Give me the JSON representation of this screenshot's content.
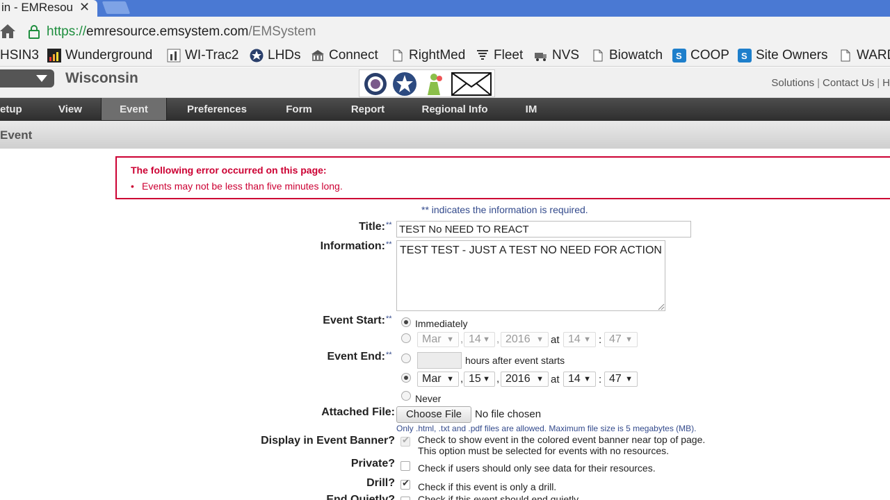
{
  "browser": {
    "tab_title": "in - EMResou",
    "tab_close": "✕",
    "url_scheme": "https://",
    "url_host": "emresource.emsystem.com",
    "url_path": "/EMSystem",
    "bookmarks": [
      "HSIN3",
      "Wunderground",
      "WI-Trac2",
      "LHDs",
      "Connect",
      "RightMed",
      "Fleet",
      "NVS",
      "Biowatch",
      "COOP",
      "Site Owners",
      "WARD"
    ]
  },
  "header": {
    "region": "Wisconsin",
    "links": [
      "Solutions",
      "Contact Us",
      "H"
    ]
  },
  "nav": {
    "items": [
      "etup",
      "View",
      "Event",
      "Preferences",
      "Form",
      "Report",
      "Regional Info",
      "IM"
    ],
    "active": "Event"
  },
  "subbar": {
    "title": "Event"
  },
  "error": {
    "title": "The following error occurred on this page:",
    "item": "Events may not be less than five minutes long."
  },
  "form": {
    "required_note": "** indicates the information is required.",
    "req_mark": "**",
    "title_label": "Title:",
    "title_value": "TEST No NEED TO REACT",
    "info_label": "Information:",
    "info_value": "TEST TEST - JUST A TEST NO NEED FOR ACTION",
    "start_label": "Event Start:",
    "start_immediately": "Immediately",
    "start_date": {
      "month": "Mar",
      "day": "14",
      "year": "2016",
      "hour": "14",
      "minute": "47"
    },
    "at": "at",
    "comma": ",",
    "colon": ":",
    "end_label": "Event End:",
    "hours_after": "hours after event starts",
    "end_date": {
      "month": "Mar",
      "day": "15",
      "year": "2016",
      "hour": "14",
      "minute": "47"
    },
    "never": "Never",
    "file_label": "Attached File:",
    "choose_file": "Choose File",
    "no_file": "No file chosen",
    "file_note": "Only .html, .txt and .pdf files are allowed. Maximum file size is 5 megabytes (MB).",
    "banner_label": "Display in Event Banner?",
    "banner_desc1": "Check to show event in the colored event banner near top of page.",
    "banner_desc2": "This option must be selected for events with no resources.",
    "private_label": "Private?",
    "private_desc": "Check if users should only see data for their resources.",
    "drill_label": "Drill?",
    "drill_desc": "Check if this event is only a drill.",
    "endq_label": "End Quietly?",
    "endq_desc": "Check if this event should end quietly."
  },
  "colors": {
    "error": "#cc0033",
    "nav": "#3a3a3a",
    "tabbar": "#4a79d3"
  }
}
